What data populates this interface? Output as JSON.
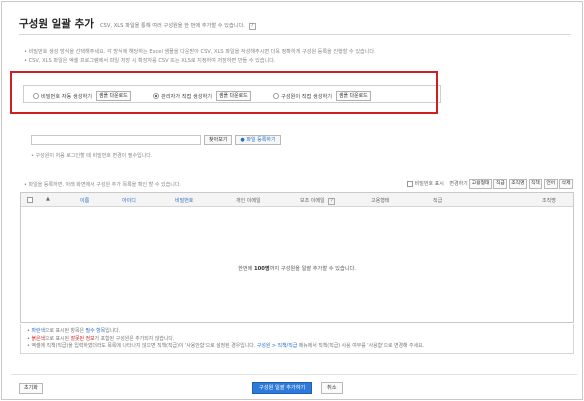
{
  "header": {
    "title": "구성원 일괄 추가",
    "subtitle": "CSV, XLS 파일을 통해 여러 구성원을 한 번에 추가할 수 있습니다.",
    "help_label": "?"
  },
  "info": {
    "line1": "• 비밀번호 생성 방식을 선택해주세요. 각 방식에 해당하는 Excel 샘플을 다운받아 CSV, XLS 파일을 작성해주시면 더욱 정확하게 구성원 등록을 진행할 수 있습니다.",
    "line2": "• CSV, XLS 파일은 엑셀 프로그램에서 파일 저장 시 확장자를 CSV 또는 XLS로 지정하여 저장하면 만들 수 있습니다."
  },
  "options": [
    {
      "label": "비밀번호 자동 생성하기",
      "button": "샘플 다운로드",
      "selected": false
    },
    {
      "label": "관리자가 직접 생성하기",
      "button": "샘플 다운로드",
      "selected": true
    },
    {
      "label": "구성원이 직접 생성하기",
      "button": "샘플 다운로드",
      "selected": false
    }
  ],
  "upload": {
    "browse_label": "찾아보기",
    "register_label": "● 파일 등록하기",
    "note": "• 구성원이 처음 로그인할 때 비밀번호 변경이 필수입니다."
  },
  "list": {
    "head_text": "• 파일을 등록하면, 아래 화면에서 구성원 추가 목록을 확인 할 수 있습니다.",
    "show_password_label": "비밀번호 표시",
    "change_label": "변경하기",
    "toolbar_buttons": [
      "고용형태",
      "직급",
      "조직명",
      "직책",
      "언어",
      "삭제"
    ]
  },
  "grid": {
    "col_name": "이름",
    "col_id": "아이디",
    "col_password": "비밀번호",
    "col_personal_email": "개인 이메일",
    "col_extra_email": "보조 이메일",
    "col_employment": "고용형태",
    "col_rank": "직급",
    "col_org": "조직명",
    "help_label": "?",
    "empty_prefix": "한번에 ",
    "empty_bold": "100명",
    "empty_suffix": "까지 구성원을 일괄 추가할 수 있습니다."
  },
  "notes": {
    "n1_bullet": "• ",
    "n1_colored": "파란색",
    "n1_mid": "으로 표시된 항목은 ",
    "n1_emph": "필수 항목",
    "n1_end": "입니다.",
    "n2_bullet": "• ",
    "n2_colored": "붉은색",
    "n2_mid": "으로 표시된 ",
    "n2_emph": "잘못된 정보",
    "n2_end": "가 포함된 구성원은 추가되지 않습니다.",
    "n3_start": "• 엑셀에 직책(직급)을 입력하였더라도 목록에 나타나지 않으면 직책(직급)이 '사용안함'으로 설정된 경우입니다. ",
    "n3_link": "구성원 > 직책/직급",
    "n3_end": " 메뉴에서 직책(직급) 사용 여부를 '사용함'으로 변경해 주세요."
  },
  "footer": {
    "reset_label": "초기화",
    "submit_label": "구성원 일괄 추가하기",
    "cancel_label": "취소"
  },
  "colors": {
    "accent": "#2e7ad8",
    "highlight_border": "#d01f1f",
    "required_blue": "#2a70c8",
    "error_red": "#d01f1f"
  }
}
